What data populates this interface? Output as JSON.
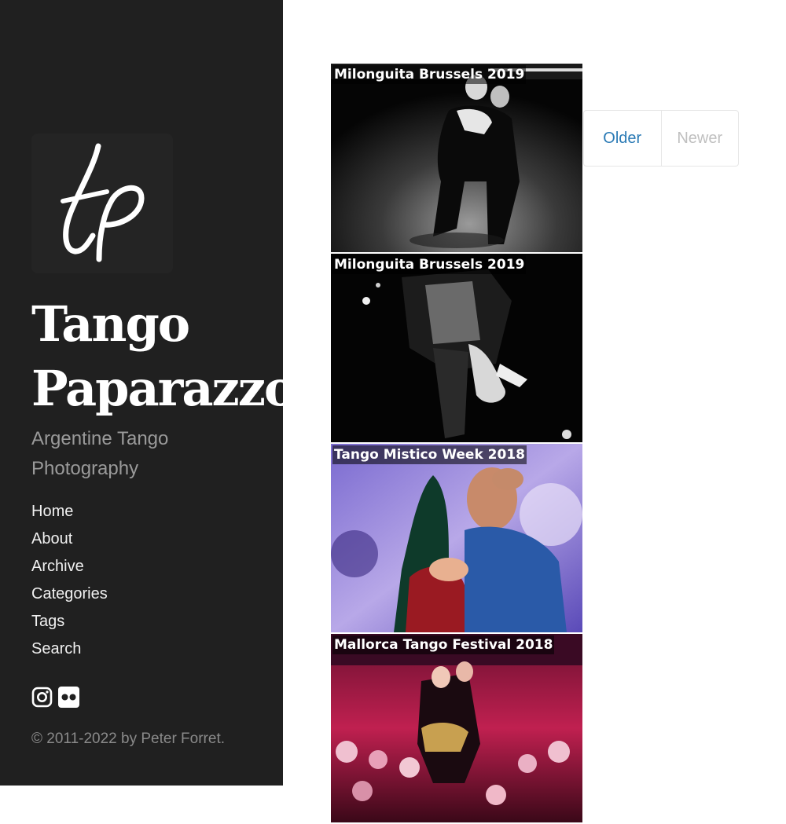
{
  "site": {
    "title_line1": "Tango",
    "title_line2": "Paparazzo",
    "tagline": "Argentine Tango Photography",
    "copyright": "© 2011-2022 by Peter Forret."
  },
  "nav": {
    "items": [
      {
        "label": "Home"
      },
      {
        "label": "About"
      },
      {
        "label": "Archive"
      },
      {
        "label": "Categories"
      },
      {
        "label": "Tags"
      },
      {
        "label": "Search"
      }
    ]
  },
  "social": {
    "icons": [
      "instagram-icon",
      "flickr-icon"
    ]
  },
  "posts": [
    {
      "title": "Milonguita Brussels 2019"
    },
    {
      "title": "Milonguita Brussels 2019"
    },
    {
      "title": "Tango Mistico Week 2018"
    },
    {
      "title": "Mallorca Tango Festival 2018"
    }
  ],
  "pager": {
    "older_label": "Older",
    "newer_label": "Newer"
  },
  "colors": {
    "sidebar_bg": "#202020",
    "link_accent": "#2a7ab5",
    "disabled_text": "#c0c0c0"
  }
}
